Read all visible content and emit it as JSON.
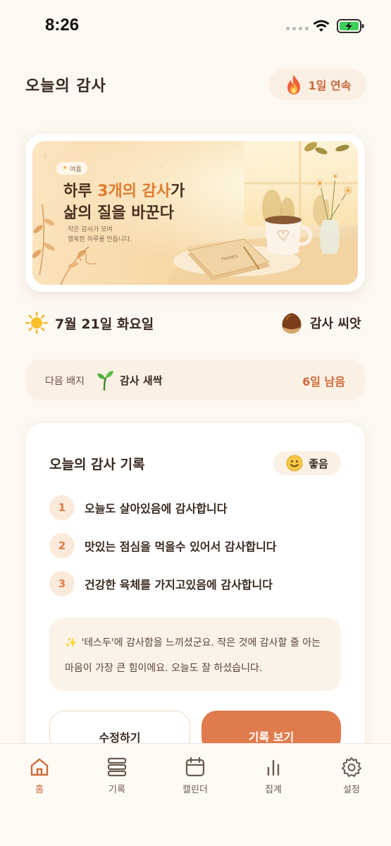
{
  "status_bar": {
    "time": "8:26"
  },
  "header": {
    "title": "오늘의 감사",
    "streak": "1일 연속"
  },
  "banner": {
    "season": "여름",
    "headline_pre": "하루 ",
    "headline_accent": "3개의 감사",
    "headline_post": "가",
    "headline_line2": "삶의 질을 바꾼다",
    "sub_line1": "작은 감사가 모여",
    "sub_line2": "행복한 하루를 만듭니다.",
    "book_label": "THANKS"
  },
  "date_row": {
    "date": "7월 21일 화요일",
    "seed_label": "감사 씨앗"
  },
  "next_badge": {
    "label": "다음 배지",
    "name": "감사 새싹",
    "remaining": "6일 남음"
  },
  "record": {
    "title": "오늘의 감사 기록",
    "mood": "좋음",
    "items": [
      {
        "num": "1",
        "text": "오늘도 살아있음에 감사합니다"
      },
      {
        "num": "2",
        "text": "맛있는 점심을 먹을수 있어서 감사합니다"
      },
      {
        "num": "3",
        "text": "건강한 육체를 가지고있음에 감사합니다"
      }
    ],
    "message": "'테스두'에 감사함을 느끼셨군요. 작은 것에 감사할 줄 아는 마음이 가장 큰 힘이에요. 오늘도 잘 하셨습니다.",
    "edit_label": "수정하기",
    "view_label": "기록 보기"
  },
  "nav": {
    "items": [
      {
        "label": "홈",
        "icon": "home-icon"
      },
      {
        "label": "기록",
        "icon": "records-icon"
      },
      {
        "label": "캘린더",
        "icon": "calendar-icon"
      },
      {
        "label": "집계",
        "icon": "stats-icon"
      },
      {
        "label": "설정",
        "icon": "settings-icon"
      }
    ]
  },
  "colors": {
    "accent": "#df7b4c",
    "background": "#fdf8f2",
    "active_nav": "#d06a3a"
  }
}
